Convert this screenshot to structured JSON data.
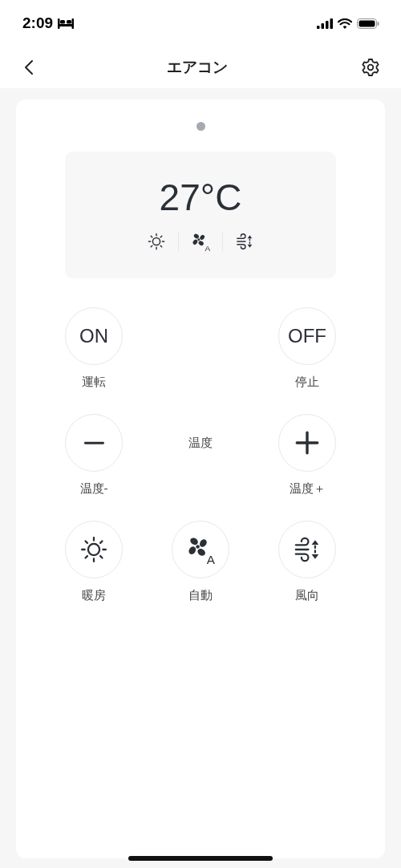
{
  "status_bar": {
    "time": "2:09"
  },
  "header": {
    "title": "エアコン"
  },
  "pager": [
    {
      "selected": true
    }
  ],
  "display": {
    "temperature": "27°C",
    "modes": [
      {
        "kind": "heat"
      },
      {
        "kind": "fan",
        "badge": "A"
      },
      {
        "kind": "swing"
      }
    ]
  },
  "controls": [
    {
      "kind": "text",
      "label": "ON",
      "caption": "運転"
    },
    {
      "kind": "empty"
    },
    {
      "kind": "text",
      "label": "OFF",
      "caption": "停止"
    },
    {
      "kind": "minus",
      "caption": "温度-"
    },
    {
      "kind": "label",
      "caption": "温度"
    },
    {
      "kind": "plus",
      "caption": "温度＋"
    },
    {
      "kind": "heat",
      "caption": "暖房"
    },
    {
      "kind": "fan",
      "badge": "A",
      "caption": "自動"
    },
    {
      "kind": "swing",
      "caption": "風向"
    }
  ]
}
